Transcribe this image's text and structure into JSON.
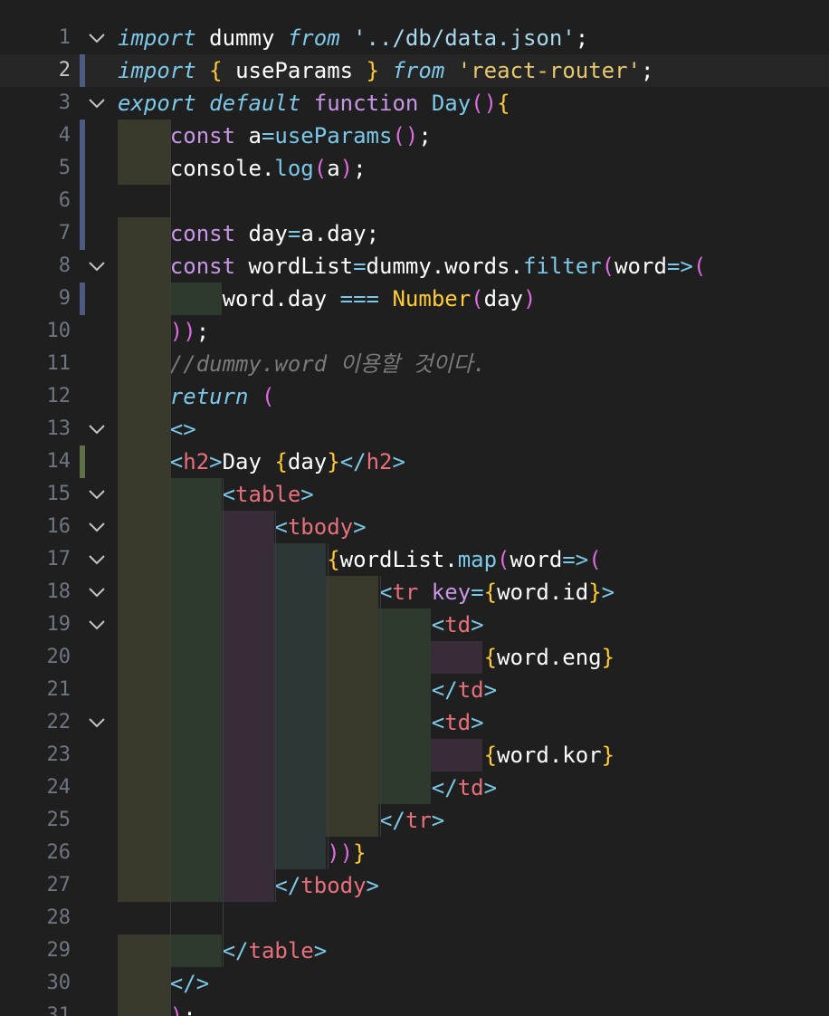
{
  "editor": {
    "theme": {
      "background": "#1f1f1f",
      "current_line": "#262626",
      "line_number": "#6e7681"
    },
    "lines": [
      {
        "n": "1",
        "text": "import dummy from '../db/data.json';"
      },
      {
        "n": "2",
        "text": "import { useParams } from 'react-router';"
      },
      {
        "n": "3",
        "text": "export default function Day(){"
      },
      {
        "n": "4",
        "text": "    const a=useParams();"
      },
      {
        "n": "5",
        "text": "    console.log(a);"
      },
      {
        "n": "6",
        "text": ""
      },
      {
        "n": "7",
        "text": "    const day=a.day;"
      },
      {
        "n": "8",
        "text": "    const wordList=dummy.words.filter(word=>("
      },
      {
        "n": "9",
        "text": "        word.day === Number(day)"
      },
      {
        "n": "10",
        "text": "    ));"
      },
      {
        "n": "11",
        "text": "    //dummy.word 이용할 것이다."
      },
      {
        "n": "12",
        "text": "    return ("
      },
      {
        "n": "13",
        "text": "    <>"
      },
      {
        "n": "14",
        "text": "    <h2>Day {day}</h2>"
      },
      {
        "n": "15",
        "text": "        <table>"
      },
      {
        "n": "16",
        "text": "            <tbody>"
      },
      {
        "n": "17",
        "text": "                {wordList.map(word=>("
      },
      {
        "n": "18",
        "text": "                    <tr key={word.id}>"
      },
      {
        "n": "19",
        "text": "                        <td>"
      },
      {
        "n": "20",
        "text": "                            {word.eng}"
      },
      {
        "n": "21",
        "text": "                        </td>"
      },
      {
        "n": "22",
        "text": "                        <td>"
      },
      {
        "n": "23",
        "text": "                            {word.kor}"
      },
      {
        "n": "24",
        "text": "                        </td>"
      },
      {
        "n": "25",
        "text": "                    </tr>"
      },
      {
        "n": "26",
        "text": "                ))}"
      },
      {
        "n": "27",
        "text": "            </tbody>"
      },
      {
        "n": "28",
        "text": ""
      },
      {
        "n": "29",
        "text": "        </table>"
      },
      {
        "n": "30",
        "text": "    </>"
      },
      {
        "n": "31",
        "text": "    );"
      }
    ]
  }
}
